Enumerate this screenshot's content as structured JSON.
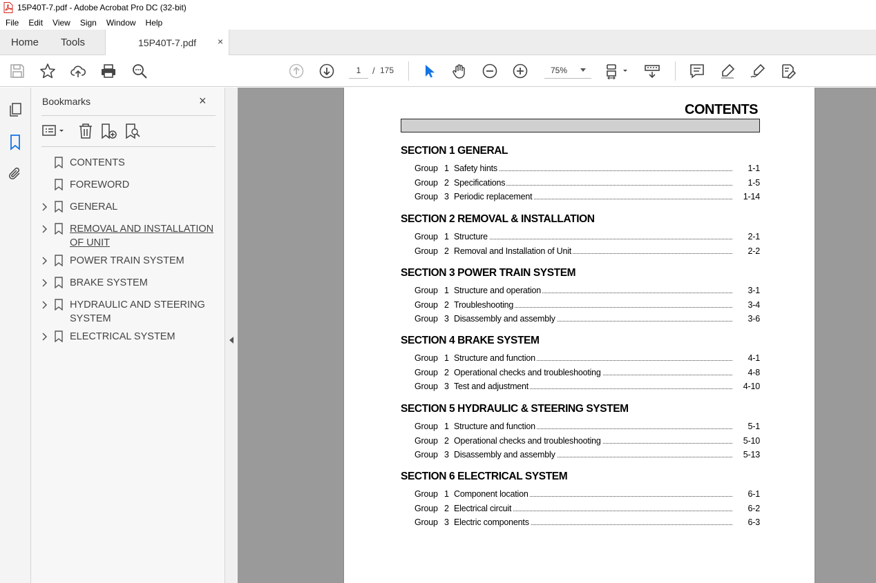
{
  "window": {
    "title": "15P40T-7.pdf - Adobe Acrobat Pro DC (32-bit)"
  },
  "menu": [
    "File",
    "Edit",
    "View",
    "Sign",
    "Window",
    "Help"
  ],
  "tabs": {
    "home": "Home",
    "tools": "Tools",
    "document": "15P40T-7.pdf",
    "close": "×"
  },
  "toolbar": {
    "page_current": "1",
    "page_separator": "/",
    "page_total": "175",
    "zoom": "75%"
  },
  "bookmarks": {
    "title": "Bookmarks",
    "close": "×",
    "items": [
      {
        "label": "CONTENTS",
        "expandable": false
      },
      {
        "label": "FOREWORD",
        "expandable": false
      },
      {
        "label": "GENERAL",
        "expandable": true
      },
      {
        "label": "REMOVAL AND INSTALLATION OF UNIT",
        "expandable": true,
        "active": true
      },
      {
        "label": "POWER TRAIN SYSTEM",
        "expandable": true
      },
      {
        "label": "BRAKE SYSTEM",
        "expandable": true
      },
      {
        "label": "HYDRAULIC AND STEERING SYSTEM",
        "expandable": true
      },
      {
        "label": "ELECTRICAL SYSTEM",
        "expandable": true
      }
    ]
  },
  "document": {
    "heading": "CONTENTS",
    "sections": [
      {
        "title": "SECTION 1  GENERAL",
        "groups": [
          {
            "g": "Group",
            "n": "1",
            "t": "Safety hints",
            "p": "1-1"
          },
          {
            "g": "Group",
            "n": "2",
            "t": "Specifications",
            "p": "1-5"
          },
          {
            "g": "Group",
            "n": "3",
            "t": "Periodic replacement",
            "p": "1-14"
          }
        ]
      },
      {
        "title": "SECTION 2  REMOVAL & INSTALLATION",
        "groups": [
          {
            "g": "Group",
            "n": "1",
            "t": "Structure",
            "p": "2-1"
          },
          {
            "g": "Group",
            "n": "2",
            "t": "Removal and Installation of Unit",
            "p": "2-2"
          }
        ]
      },
      {
        "title": "SECTION 3  POWER TRAIN SYSTEM",
        "groups": [
          {
            "g": "Group",
            "n": "1",
            "t": "Structure and operation",
            "p": "3-1"
          },
          {
            "g": "Group",
            "n": "2",
            "t": "Troubleshooting",
            "p": "3-4"
          },
          {
            "g": "Group",
            "n": "3",
            "t": "Disassembly and assembly",
            "p": "3-6"
          }
        ]
      },
      {
        "title": "SECTION 4  BRAKE SYSTEM",
        "groups": [
          {
            "g": "Group",
            "n": "1",
            "t": "Structure and function",
            "p": "4-1"
          },
          {
            "g": "Group",
            "n": "2",
            "t": "Operational checks and troubleshooting",
            "p": "4-8"
          },
          {
            "g": "Group",
            "n": "3",
            "t": "Test and adjustment",
            "p": "4-10"
          }
        ]
      },
      {
        "title": "SECTION 5  HYDRAULIC & STEERING SYSTEM",
        "groups": [
          {
            "g": "Group",
            "n": "1",
            "t": "Structure and function",
            "p": "5-1"
          },
          {
            "g": "Group",
            "n": "2",
            "t": "Operational checks and troubleshooting",
            "p": "5-10"
          },
          {
            "g": "Group",
            "n": "3",
            "t": "Disassembly and assembly",
            "p": "5-13"
          }
        ]
      },
      {
        "title": "SECTION 6  ELECTRICAL SYSTEM",
        "groups": [
          {
            "g": "Group",
            "n": "1",
            "t": "Component location",
            "p": "6-1"
          },
          {
            "g": "Group",
            "n": "2",
            "t": "Electrical circuit",
            "p": "6-2"
          },
          {
            "g": "Group",
            "n": "3",
            "t": "Electric components",
            "p": "6-3"
          }
        ]
      }
    ]
  },
  "icons": {
    "app": "pdf-file-icon",
    "save": "save-icon",
    "star": "star-icon",
    "upload": "cloud-upload-icon",
    "print": "print-icon",
    "find": "find-zoom-icon",
    "prev": "previous-page-icon",
    "next": "next-page-icon",
    "select": "select-pointer-icon",
    "hand": "hand-icon",
    "zoom_out": "zoom-out-icon",
    "zoom_in": "zoom-in-icon",
    "fit": "page-fit-icon",
    "scroll": "scroll-mode-icon",
    "comment": "comment-icon",
    "highlight": "highlight-icon",
    "sign": "sign-icon",
    "edit": "edit-pdf-icon"
  },
  "colors": {
    "accent": "#1473e6",
    "doc_background": "#9a9a9a",
    "pdf_red": "#d4281f"
  }
}
